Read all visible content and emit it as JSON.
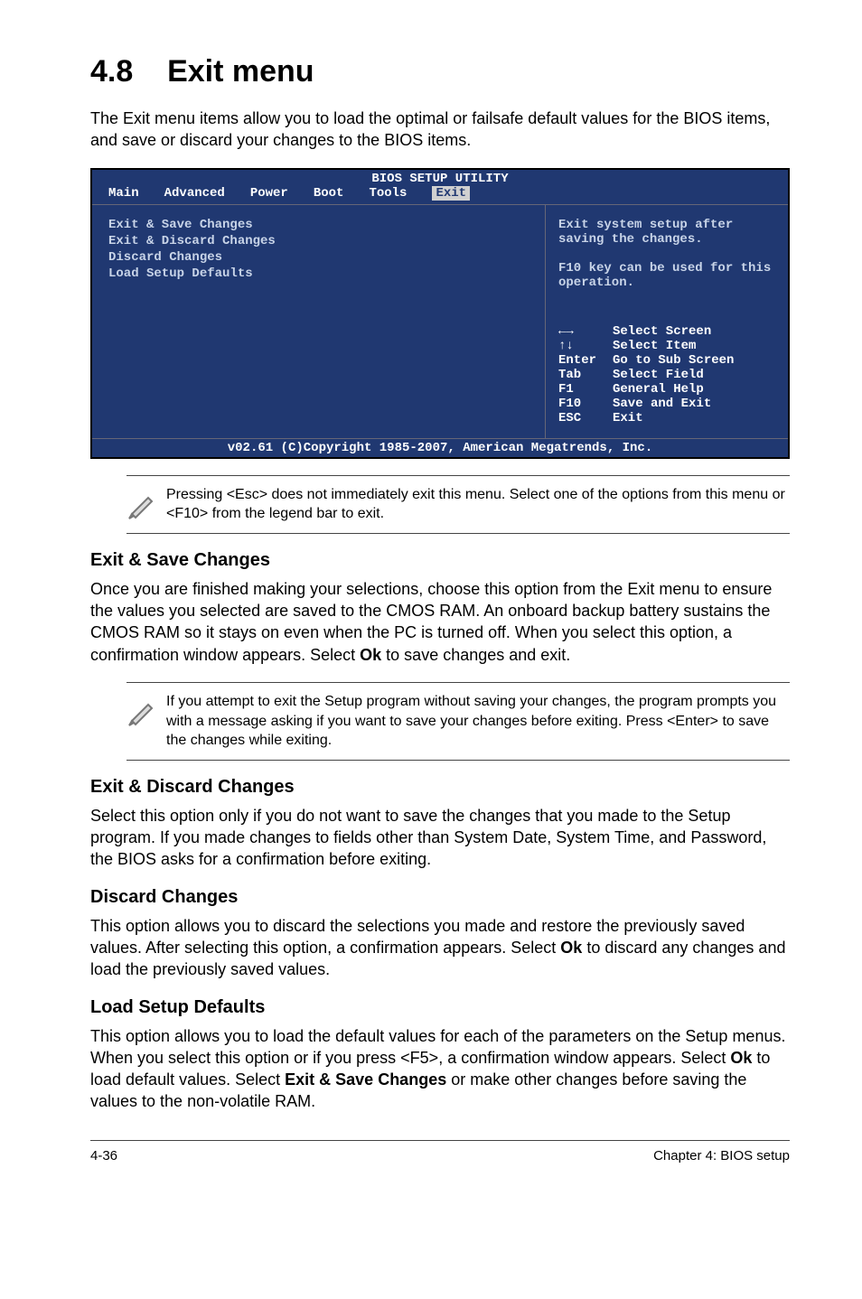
{
  "section": {
    "number": "4.8",
    "title": "Exit menu"
  },
  "intro": "The Exit menu items allow you to load the optimal or failsafe default values for the BIOS items, and save or discard your changes to the BIOS items.",
  "bios": {
    "title": "BIOS SETUP UTILITY",
    "menu": [
      "Main",
      "Advanced",
      "Power",
      "Boot",
      "Tools"
    ],
    "menu_active": "Exit",
    "left_items": [
      "Exit & Save Changes",
      "Exit & Discard Changes",
      "Discard Changes",
      "",
      "Load Setup Defaults"
    ],
    "help_top": "Exit system setup after saving the changes.\n\nF10 key can be used for this operation.",
    "keys": [
      {
        "k": "←→",
        "d": "Select Screen"
      },
      {
        "k": "↑↓",
        "d": "Select Item"
      },
      {
        "k": "Enter",
        "d": "Go to Sub Screen"
      },
      {
        "k": "Tab",
        "d": "Select Field"
      },
      {
        "k": "F1",
        "d": "General Help"
      },
      {
        "k": "F10",
        "d": "Save and Exit"
      },
      {
        "k": "ESC",
        "d": "Exit"
      }
    ],
    "footer": "v02.61 (C)Copyright 1985-2007, American Megatrends, Inc."
  },
  "note1": "Pressing <Esc> does not immediately exit this menu. Select one of the options from this menu or <F10> from the legend bar to exit.",
  "exit_save": {
    "heading": "Exit & Save Changes",
    "body_a": "Once you are finished making your selections, choose this option from the Exit menu to ensure the values you selected are saved to the CMOS RAM. An onboard backup battery sustains the CMOS RAM so it stays on even when the PC is turned off. When you select this option, a confirmation window appears. Select ",
    "ok": "Ok",
    "body_b": " to save changes and exit."
  },
  "note2": "If you attempt to exit the Setup program without saving your changes, the program prompts you with a message asking if you want to save your changes before exiting. Press <Enter> to save the changes while exiting.",
  "exit_discard": {
    "heading": "Exit & Discard Changes",
    "body": "Select this option only if you do not want to save the changes that you  made to the Setup program. If you made changes to fields other than System Date, System Time, and Password, the BIOS asks for a confirmation before exiting."
  },
  "discard": {
    "heading": "Discard Changes",
    "body_a": "This option allows you to discard the selections you made and restore the previously saved values. After selecting this option, a confirmation appears. Select ",
    "ok": "Ok",
    "body_b": " to discard any changes and load the previously saved values."
  },
  "load": {
    "heading": "Load Setup Defaults",
    "body_a": "This option allows you to load the default values for each of the parameters on the Setup menus. When you select this option or if you press <F5>, a confirmation window appears. Select ",
    "ok1": "Ok",
    "body_b": " to load default values. Select ",
    "exit_save": "Exit & Save Changes",
    "body_c": " or make other changes before saving the values to the non-volatile RAM."
  },
  "footer": {
    "left": "4-36",
    "right": "Chapter 4: BIOS setup"
  }
}
